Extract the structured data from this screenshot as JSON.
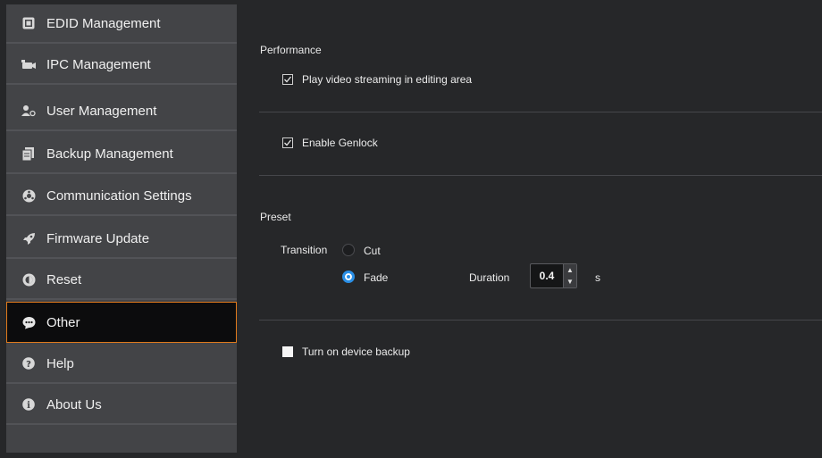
{
  "sidebar": {
    "items": [
      {
        "label": "EDID Management",
        "icon": "edid-icon"
      },
      {
        "label": "IPC Management",
        "icon": "ipc-icon"
      },
      {
        "label": "User Management",
        "icon": "user-icon"
      },
      {
        "label": "Backup Management",
        "icon": "backup-icon"
      },
      {
        "label": "Communication Settings",
        "icon": "communication-icon"
      },
      {
        "label": "Firmware Update",
        "icon": "rocket-icon"
      },
      {
        "label": "Reset",
        "icon": "reset-icon"
      },
      {
        "label": "Other",
        "icon": "chat-icon",
        "active": true
      },
      {
        "label": "Help",
        "icon": "help-icon"
      },
      {
        "label": "About Us",
        "icon": "info-icon"
      }
    ]
  },
  "performance": {
    "title": "Performance",
    "play_video_label": "Play video streaming in editing area",
    "play_video_checked": true,
    "genlock_label": "Enable Genlock",
    "genlock_checked": true
  },
  "preset": {
    "title": "Preset",
    "transition_label": "Transition",
    "cut_label": "Cut",
    "fade_label": "Fade",
    "selected": "Fade",
    "duration_label": "Duration",
    "duration_value": "0.4",
    "duration_unit": "s"
  },
  "backup": {
    "label": "Turn on device backup",
    "checked": false
  },
  "colors": {
    "accent_orange": "#e07a1c",
    "radio_blue": "#2a8fe6",
    "sidebar_bg": "#434447",
    "main_bg": "#262729"
  }
}
